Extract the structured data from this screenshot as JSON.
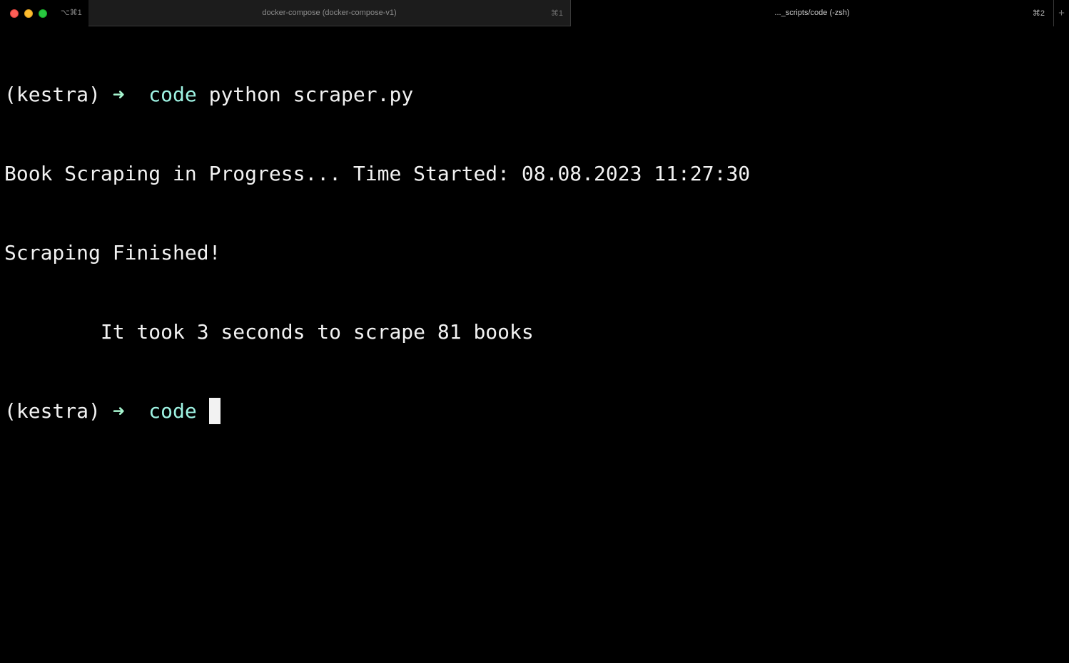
{
  "window": {
    "shortcut": "⌥⌘1",
    "new_tab_label": "+"
  },
  "tabs": [
    {
      "title": "docker-compose (docker-compose-v1)",
      "shortcut": "⌘1",
      "active": false
    },
    {
      "title": "..._scripts/code (-zsh)",
      "shortcut": "⌘2",
      "active": true
    }
  ],
  "terminal": {
    "prompt": {
      "env": "(kestra)",
      "arrow": "➜",
      "dir": "code"
    },
    "command": "python scraper.py",
    "output": [
      "Book Scraping in Progress... Time Started: 08.08.2023 11:27:30",
      "Scraping Finished!",
      "        It took 3 seconds to scrape 81 books"
    ]
  },
  "colors": {
    "background": "#000000",
    "text": "#f2f2f2",
    "prompt_arrow": "#a6f5cf",
    "prompt_dir": "#9ef3e3",
    "close": "#fe5f57",
    "minimize": "#febc2e",
    "maximize": "#28c840"
  }
}
